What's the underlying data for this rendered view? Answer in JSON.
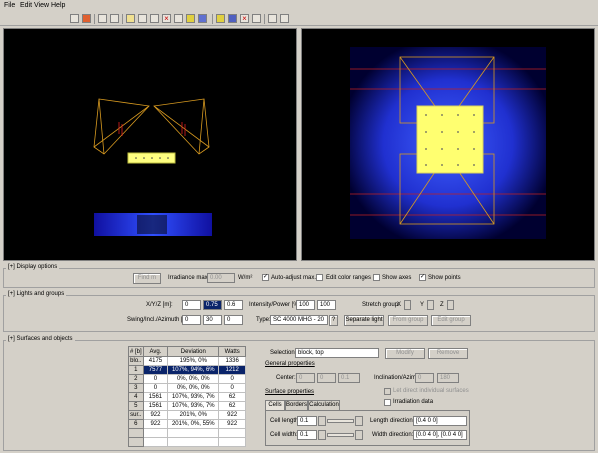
{
  "menu": [
    "File",
    "Edit",
    "View",
    "Help"
  ],
  "display_options": {
    "title": "[+] Display options",
    "find_max": "Find m",
    "irradiance_label": "Irradiance max.",
    "irradiance_value": "0.00",
    "irradiance_unit": "W/m²",
    "auto_adjust": "Auto-adjust max.",
    "edit_color_ranges": "Edit color ranges",
    "show_axes": "Show axes",
    "show_points": "Show points"
  },
  "lights": {
    "title": "[+] Lights and groups",
    "xyz_label": "X/Y/Z [m]:",
    "x": "0",
    "y": "0.75",
    "z": "0.6",
    "swing_label": "Swing/Incl./Azimuth [°]:",
    "swing": "0",
    "incl": "30",
    "azimuth": "0",
    "intensity_label": "Intensity/Power [%]:",
    "intensity": "100",
    "power": "100",
    "type_label": "Type:",
    "type_value": "SC 4000 MHG - 20",
    "help": "?",
    "stretch_label": "Stretch group:",
    "sx": "X",
    "sy": "Y",
    "sz": "Z",
    "separate": "Separate light",
    "from_group": "From group",
    "edit_group": "Edit group"
  },
  "surfaces": {
    "title": "[+] Surfaces and objects",
    "columns": [
      "# [b]",
      "Avg.",
      "Deviation",
      "Watts"
    ],
    "rows": [
      [
        "blo..",
        "4175",
        "195%, 0%",
        "1336"
      ],
      [
        "1",
        "7577",
        "107%, 94%, 6%",
        "1212"
      ],
      [
        "2",
        "0",
        "0%, 0%, 0%",
        "0"
      ],
      [
        "3",
        "0",
        "0%, 0%, 0%",
        "0"
      ],
      [
        "4",
        "1561",
        "107%, 93%, 7%",
        "62"
      ],
      [
        "5",
        "1561",
        "107%, 93%, 7%",
        "62"
      ],
      [
        "sur..",
        "922",
        "201%, 0%",
        "922"
      ],
      [
        "6",
        "922",
        "201%, 0%, 55%",
        "922"
      ]
    ],
    "selection_label": "Selection:",
    "selection_value": "block, top",
    "modify": "Modify",
    "remove": "Remove",
    "general_props": "General properties",
    "center_label": "Center:",
    "cx": "0",
    "cy": "0",
    "cz": "0.1",
    "incl_az_label": "Inclination/Azimuth:",
    "incl_val": "0",
    "az_val": "180",
    "grid_direct": "Let direct individual surfaces",
    "irradiation_data": "Irradiation data",
    "surface_props": "Surface properties",
    "tabs": [
      "Cells",
      "Borders",
      "Calculation"
    ],
    "cell_length_label": "Cell length:",
    "cell_length": "0.1",
    "cell_width_label": "Cell width:",
    "cell_width": "0.1",
    "length_dir_label": "Length direction:",
    "length_dir": "[0.4 0 0]",
    "width_dir_label": "Width direction:",
    "width_dir": "[0.0 4 0], [0.0 4 0]"
  }
}
